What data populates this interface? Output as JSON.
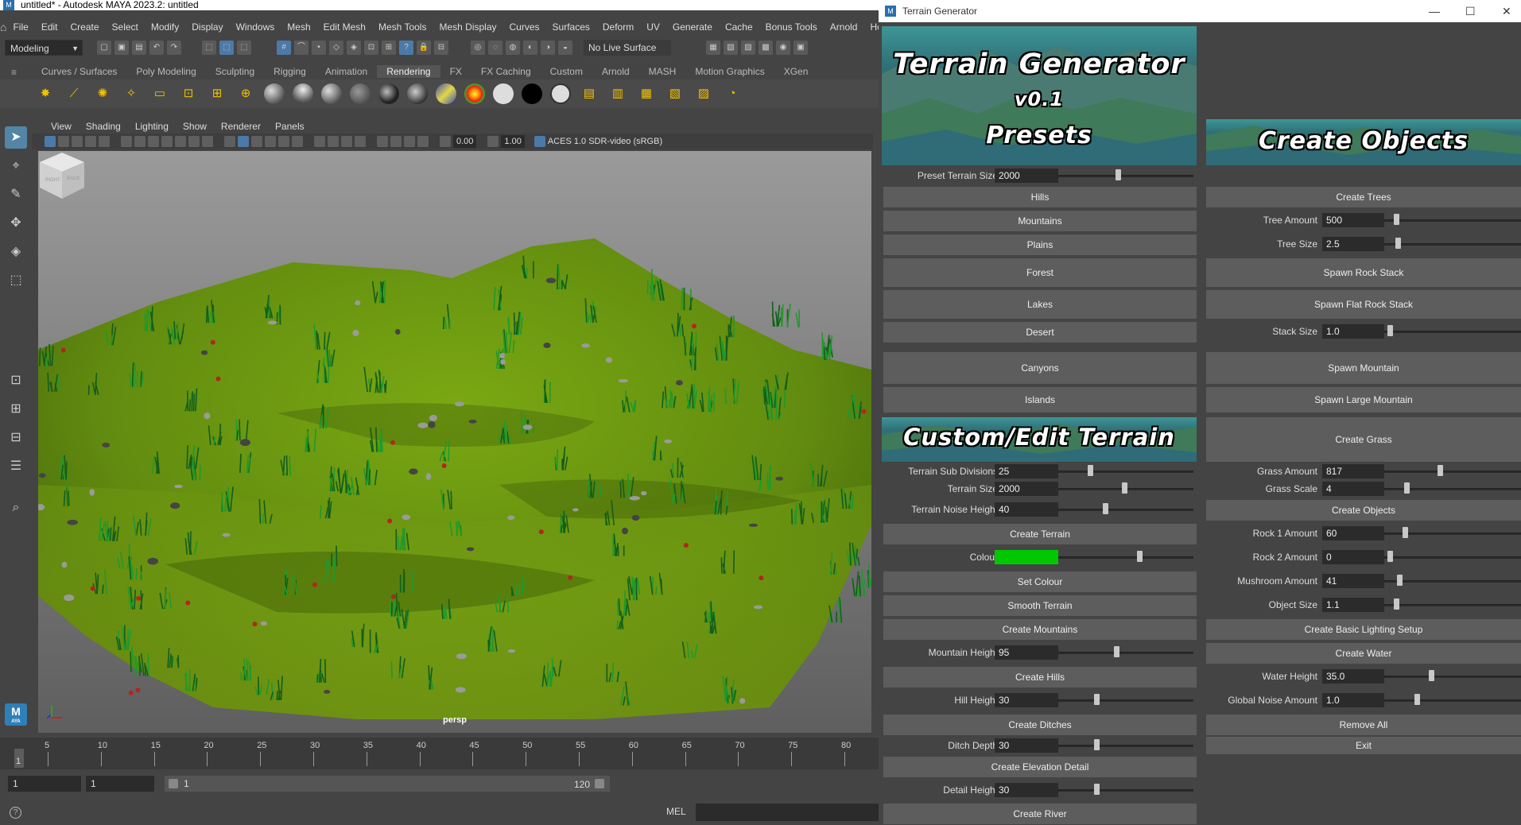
{
  "maya": {
    "title": "untitled* - Autodesk MAYA 2023.2: untitled",
    "menu": [
      "File",
      "Edit",
      "Create",
      "Select",
      "Modify",
      "Display",
      "Windows",
      "Mesh",
      "Edit Mesh",
      "Mesh Tools",
      "Mesh Display",
      "Curves",
      "Surfaces",
      "Deform",
      "UV",
      "Generate",
      "Cache",
      "Bonus Tools",
      "Arnold",
      "Help"
    ],
    "mode": "Modeling",
    "live_surface": "No Live Surface",
    "shelf_tabs": [
      "Curves / Surfaces",
      "Poly Modeling",
      "Sculpting",
      "Rigging",
      "Animation",
      "Rendering",
      "FX",
      "FX Caching",
      "Custom",
      "Arnold",
      "MASH",
      "Motion Graphics",
      "XGen"
    ],
    "active_shelf_tab": "Rendering",
    "viewport_menu": [
      "View",
      "Shading",
      "Lighting",
      "Show",
      "Renderer",
      "Panels"
    ],
    "viewport_values": {
      "a": "0.00",
      "b": "1.00",
      "colorspace": "ACES 1.0 SDR-video (sRGB)"
    },
    "camera": "persp",
    "cube_faces": {
      "right": "RIGHT",
      "back": "BACK"
    },
    "timeline_ticks": [
      "5",
      "10",
      "15",
      "20",
      "25",
      "30",
      "35",
      "40",
      "45",
      "50",
      "55",
      "60",
      "65",
      "70",
      "75",
      "80"
    ],
    "current_frame": "1",
    "range": {
      "start": "1",
      "inner_start": "1",
      "slider_start": "1",
      "slider_end": "120"
    },
    "cmd_label": "MEL",
    "help_icon_label": "?",
    "logo_label": "M",
    "logo_sub": "AYA"
  },
  "tg": {
    "title": "Terrain Generator",
    "banner_title": "Terrain Generator",
    "banner_version": "v0.1",
    "presets_header": "Presets",
    "create_objects_header": "Create Objects",
    "custom_header": "Custom/Edit Terrain",
    "preset_size": {
      "label": "Preset Terrain Size",
      "value": "2000"
    },
    "presets": [
      "Hills",
      "Mountains",
      "Plains",
      "Forest",
      "Lakes",
      "Desert",
      "Canyons",
      "Islands"
    ],
    "terrain_sub_divisions": {
      "label": "Terrain Sub Divisions",
      "value": "25"
    },
    "terrain_size": {
      "label": "Terrain Size",
      "value": "2000"
    },
    "terrain_noise_height": {
      "label": "Terrain Noise Height",
      "value": "40"
    },
    "create_terrain": "Create Terrain",
    "colour": {
      "label": "Colour",
      "value": "#00c800"
    },
    "set_colour": "Set Colour",
    "smooth_terrain": "Smooth Terrain",
    "create_mountains": "Create Mountains",
    "mountain_height": {
      "label": "Mountain Height",
      "value": "95"
    },
    "create_hills": "Create Hills",
    "hill_height": {
      "label": "Hill Height",
      "value": "30"
    },
    "create_ditches": "Create Ditches",
    "ditch_depth": {
      "label": "Ditch Depth",
      "value": "30"
    },
    "create_elevation_detail": "Create Elevation Detail",
    "detail_height": {
      "label": "Detail Height",
      "value": "30"
    },
    "create_river": "Create River",
    "create_trees": "Create Trees",
    "tree_amount": {
      "label": "Tree Amount",
      "value": "500"
    },
    "tree_size": {
      "label": "Tree Size",
      "value": "2.5"
    },
    "spawn_rock_stack": "Spawn Rock Stack",
    "spawn_flat_rock_stack": "Spawn Flat Rock Stack",
    "stack_size": {
      "label": "Stack Size",
      "value": "1.0"
    },
    "spawn_mountain": "Spawn Mountain",
    "spawn_large_mountain": "Spawn Large Mountain",
    "create_grass": "Create Grass",
    "grass_amount": {
      "label": "Grass Amount",
      "value": "817"
    },
    "grass_scale": {
      "label": "Grass Scale",
      "value": "4"
    },
    "create_objects_btn": "Create Objects",
    "rock1_amount": {
      "label": "Rock 1 Amount",
      "value": "60"
    },
    "rock2_amount": {
      "label": "Rock 2 Amount",
      "value": "0"
    },
    "mushroom_amount": {
      "label": "Mushroom Amount",
      "value": "41"
    },
    "object_size": {
      "label": "Object Size",
      "value": "1.1"
    },
    "create_lighting": "Create Basic Lighting Setup",
    "create_water": "Create Water",
    "water_height": {
      "label": "Water Height",
      "value": "35.0"
    },
    "global_noise_amount": {
      "label": "Global Noise Amount",
      "value": "1.0"
    },
    "remove_all": "Remove All",
    "exit": "Exit"
  },
  "colors": {
    "accent": "#5285a6",
    "terrain": "#6a9a10",
    "grass": "#1f9a2a"
  }
}
